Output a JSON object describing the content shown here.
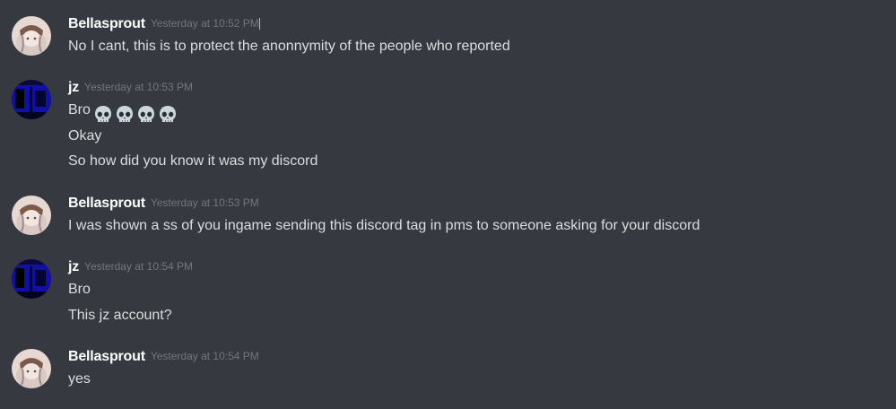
{
  "users": {
    "bellasprout": "Bellasprout",
    "jz": "jz"
  },
  "messages": [
    {
      "author": "Bellasprout",
      "timestamp": "Yesterday at 10:52 PM",
      "lines": [
        "No I cant, this is to protect the anonnymity of the people who reported"
      ]
    },
    {
      "author": "jz",
      "timestamp": "Yesterday at 10:53 PM",
      "lines": [
        "Bro",
        "Okay",
        "So how did you know it was my discord"
      ],
      "emoji": [
        "skull",
        "skull",
        "skull",
        "skull"
      ]
    },
    {
      "author": "Bellasprout",
      "timestamp": "Yesterday at 10:53 PM",
      "lines": [
        "I was shown a ss of you ingame sending this discord tag in pms to someone asking for your discord"
      ]
    },
    {
      "author": "jz",
      "timestamp": "Yesterday at 10:54 PM",
      "lines": [
        "Bro",
        "This jz account?"
      ]
    },
    {
      "author": "Bellasprout",
      "timestamp": "Yesterday at 10:54 PM",
      "lines": [
        "yes"
      ]
    }
  ],
  "colors": {
    "background": "#36393f",
    "username": "#ffffff",
    "timestamp": "#72767d",
    "message_text": "#dcddde"
  },
  "icons": {
    "bellasprout_avatar": "anime-character-avatar",
    "jz_avatar": "dark-blue-avatar",
    "emoji": "skull-emoji"
  }
}
